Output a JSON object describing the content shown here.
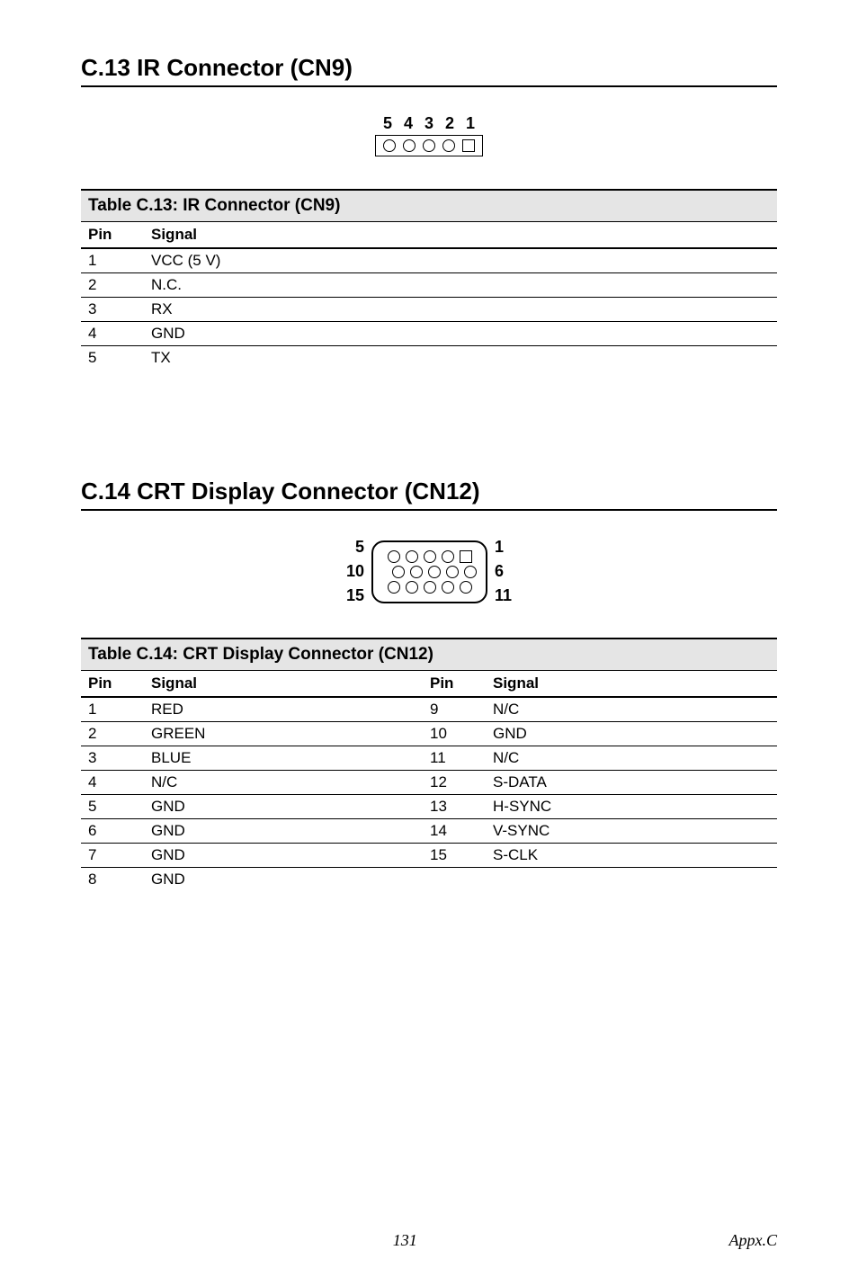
{
  "sectionC13": {
    "heading": "C.13 IR Connector (CN9)",
    "pinLabels": [
      "5",
      "4",
      "3",
      "2",
      "1"
    ],
    "tableCaption": "Table C.13: IR Connector (CN9)",
    "header": {
      "pin": "Pin",
      "signal": "Signal"
    },
    "rows": [
      {
        "pin": "1",
        "signal": "VCC (5 V)"
      },
      {
        "pin": "2",
        "signal": "N.C."
      },
      {
        "pin": "3",
        "signal": "RX"
      },
      {
        "pin": "4",
        "signal": "GND"
      },
      {
        "pin": "5",
        "signal": "TX"
      }
    ]
  },
  "sectionC14": {
    "heading": "C.14 CRT Display Connector (CN12)",
    "leftLabels": [
      "5",
      "10",
      "15"
    ],
    "rightLabels": [
      "1",
      "6",
      "11"
    ],
    "tableCaption": "Table C.14: CRT Display Connector (CN12)",
    "header": {
      "pin": "Pin",
      "signal": "Signal",
      "pin2": "Pin",
      "signal2": "Signal"
    },
    "rows": [
      {
        "pin": "1",
        "signal": "RED",
        "pin2": "9",
        "signal2": "N/C"
      },
      {
        "pin": "2",
        "signal": "GREEN",
        "pin2": "10",
        "signal2": "GND"
      },
      {
        "pin": "3",
        "signal": "BLUE",
        "pin2": "11",
        "signal2": "N/C"
      },
      {
        "pin": "4",
        "signal": "N/C",
        "pin2": "12",
        "signal2": "S-DATA"
      },
      {
        "pin": "5",
        "signal": "GND",
        "pin2": "13",
        "signal2": "H-SYNC"
      },
      {
        "pin": "6",
        "signal": "GND",
        "pin2": "14",
        "signal2": "V-SYNC"
      },
      {
        "pin": "7",
        "signal": "GND",
        "pin2": "15",
        "signal2": "S-CLK"
      },
      {
        "pin": "8",
        "signal": "GND",
        "pin2": "",
        "signal2": ""
      }
    ]
  },
  "footer": {
    "pageNum": "131",
    "appx": "Appx.C"
  }
}
